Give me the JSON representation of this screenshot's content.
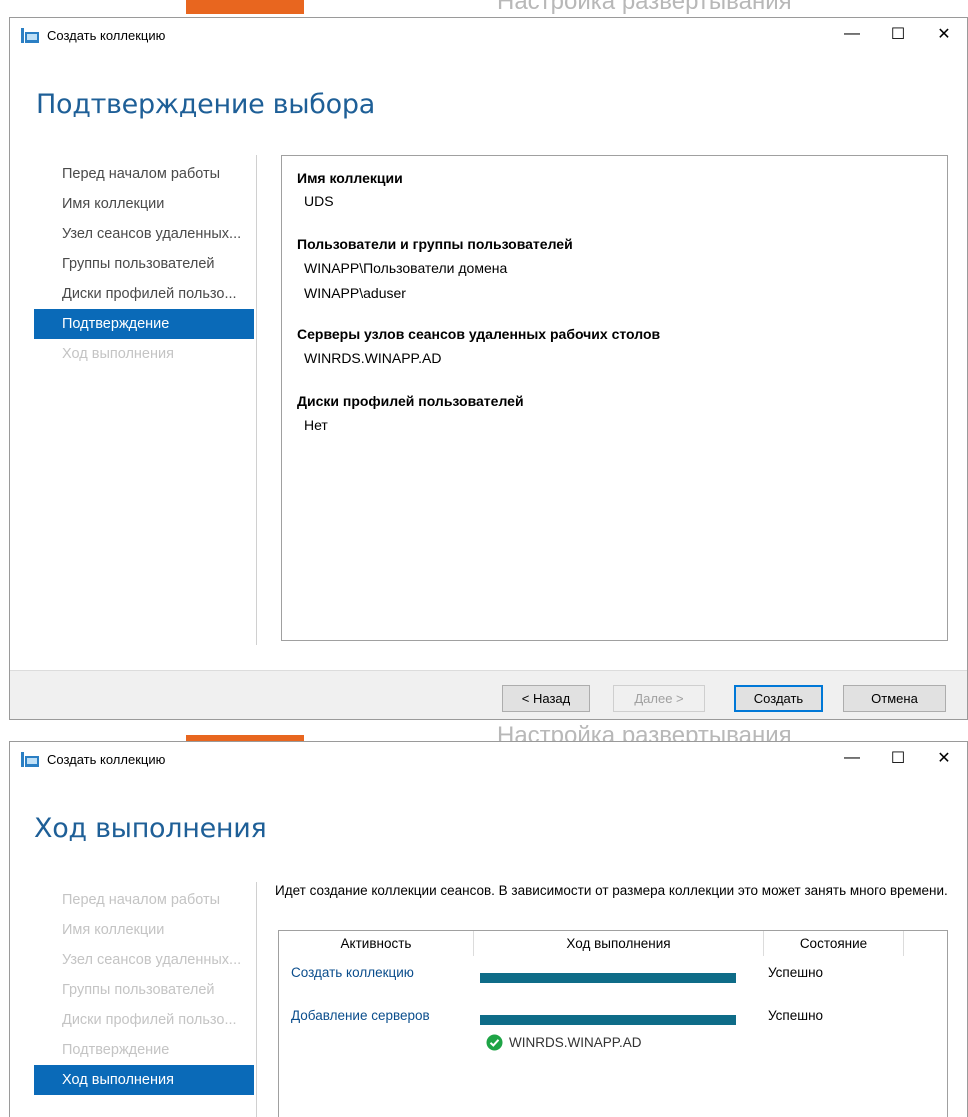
{
  "background": {
    "title_fragment": "Настройка развертывания",
    "accent_color": "#e8661f"
  },
  "window1": {
    "title": "Создать коллекцию",
    "controls": {
      "minimize": "—",
      "maximize": "☐",
      "close": "✕"
    },
    "heading": "Подтверждение выбора",
    "nav": [
      {
        "label": "Перед началом работы",
        "state": "normal"
      },
      {
        "label": "Имя коллекции",
        "state": "normal"
      },
      {
        "label": "Узел сеансов удаленных...",
        "state": "normal"
      },
      {
        "label": "Группы пользователей",
        "state": "normal"
      },
      {
        "label": "Диски профилей пользо...",
        "state": "normal"
      },
      {
        "label": "Подтверждение",
        "state": "active"
      },
      {
        "label": "Ход выполнения",
        "state": "disabled"
      }
    ],
    "sections": [
      {
        "title": "Имя коллекции",
        "values": [
          "UDS"
        ]
      },
      {
        "title": "Пользователи и группы пользователей",
        "values": [
          "WINAPP\\Пользователи домена",
          "WINAPP\\aduser"
        ]
      },
      {
        "title": "Серверы узлов сеансов удаленных рабочих столов",
        "values": [
          "WINRDS.WINAPP.AD"
        ]
      },
      {
        "title": "Диски профилей пользователей",
        "values": [
          "Нет"
        ]
      }
    ],
    "buttons": {
      "back": "< Назад",
      "next": "Далее >",
      "create": "Создать",
      "cancel": "Отмена"
    }
  },
  "window2": {
    "title": "Создать коллекцию",
    "controls": {
      "minimize": "—",
      "maximize": "☐",
      "close": "✕"
    },
    "heading": "Ход выполнения",
    "nav": [
      {
        "label": "Перед началом работы",
        "state": "disabled"
      },
      {
        "label": "Имя коллекции",
        "state": "disabled"
      },
      {
        "label": "Узел сеансов удаленных...",
        "state": "disabled"
      },
      {
        "label": "Группы пользователей",
        "state": "disabled"
      },
      {
        "label": "Диски профилей пользо...",
        "state": "disabled"
      },
      {
        "label": "Подтверждение",
        "state": "disabled"
      },
      {
        "label": "Ход выполнения",
        "state": "active"
      }
    ],
    "description": "Идет создание коллекции сеансов. В зависимости от размера коллекции это может занять много времени.",
    "grid": {
      "columns": [
        "Активность",
        "Ход выполнения",
        "Состояние"
      ],
      "rows": [
        {
          "activity": "Создать коллекцию",
          "progress": 1.0,
          "status": "Успешно"
        },
        {
          "activity": "Добавление серверов",
          "progress": 1.0,
          "status": "Успешно",
          "sub": "WINRDS.WINAPP.AD"
        }
      ]
    },
    "success_icon": "check-circle-icon",
    "success_color": "#1ea446"
  }
}
